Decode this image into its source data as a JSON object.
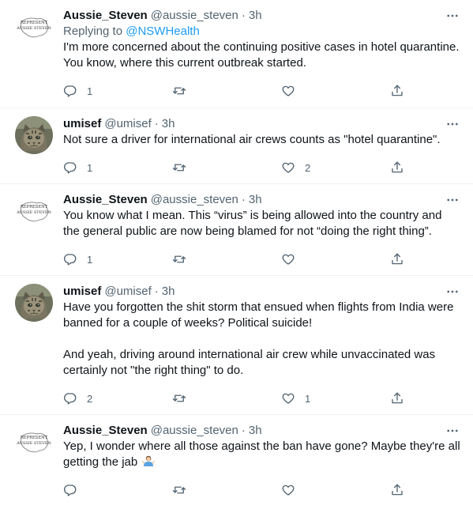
{
  "tweets": [
    {
      "avatar": "represent-aussie-steven-icon",
      "name": "Aussie_Steven",
      "handle": "@aussie_steven",
      "time": "3h",
      "replying_prefix": "Replying to ",
      "replying_to": "@NSWHealth",
      "text": "I'm more concerned about the continuing positive cases in hotel quarantine. You know, where this current outbreak started.",
      "replies": "1",
      "retweets": "",
      "likes": ""
    },
    {
      "avatar": "cat-avatar-icon",
      "name": "umisef",
      "handle": "@umisef",
      "time": "3h",
      "text": "Not sure a driver for international air crews counts as \"hotel quarantine\".",
      "replies": "1",
      "retweets": "",
      "likes": "2"
    },
    {
      "avatar": "represent-aussie-steven-icon",
      "name": "Aussie_Steven",
      "handle": "@aussie_steven",
      "time": "3h",
      "text": "You know what I mean. This “virus” is being allowed into the country and the general public are now being blamed for not “doing the right thing”.",
      "replies": "1",
      "retweets": "",
      "likes": ""
    },
    {
      "avatar": "cat-avatar-icon",
      "name": "umisef",
      "handle": "@umisef",
      "time": "3h",
      "text": "Have you forgotten the shit storm that ensued when flights from India were banned for a couple of weeks? Political suicide!\n\nAnd yeah, driving around international air crew while unvaccinated was certainly not \"the right thing\" to do.",
      "replies": "2",
      "retweets": "",
      "likes": "1"
    },
    {
      "avatar": "represent-aussie-steven-icon",
      "name": "Aussie_Steven",
      "handle": "@aussie_steven",
      "time": "3h",
      "text": "Yep, I wonder where all those against the ban have gone? Maybe they're all getting the jab",
      "emoji": "person-shrugging-emoji",
      "replies": "",
      "retweets": "",
      "likes": ""
    }
  ],
  "separator": "·",
  "steven_avatar_text": [
    "REPRESENT",
    "AUSSIE STEVEN"
  ],
  "colors": {
    "text": "#0f1419",
    "secondary": "#536471",
    "link": "#1d9bf0",
    "divider": "#eff3f4"
  }
}
